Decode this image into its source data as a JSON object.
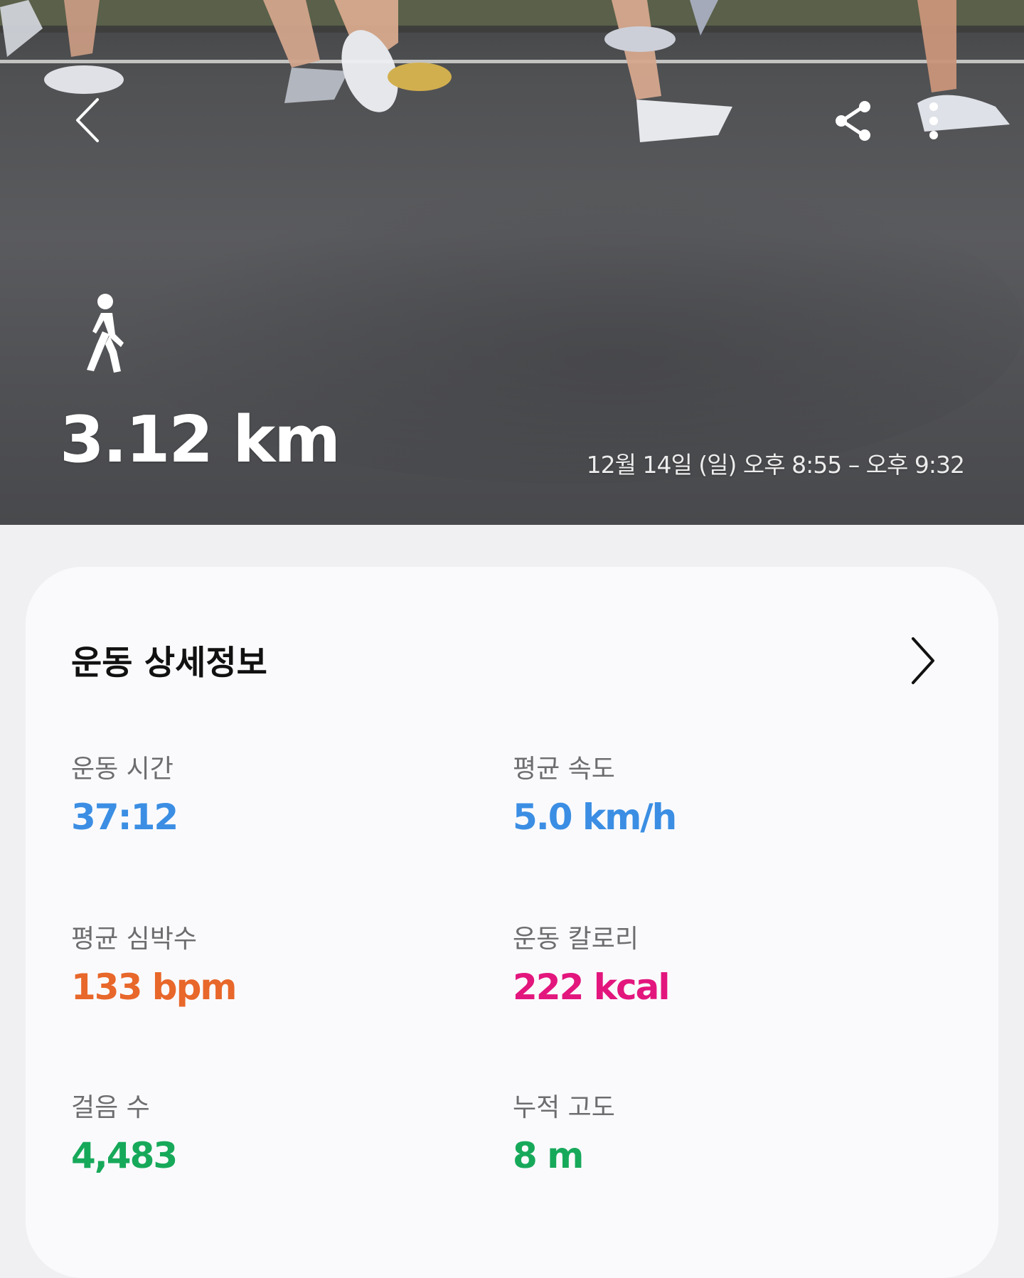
{
  "hero": {
    "distance": "3.12 km",
    "date_range": "12월 14일 (일) 오후 8:55 – 오후 9:32",
    "back_icon": "chevron-left-icon",
    "share_icon": "share-icon",
    "more_icon": "more-vertical-icon",
    "activity_icon": "walking-person-icon"
  },
  "details": {
    "title": "운동 상세정보",
    "chevron_icon": "chevron-right-icon",
    "stats": [
      {
        "label": "운동 시간",
        "value": "37:12",
        "color": "#3b8ee3"
      },
      {
        "label": "평균 속도",
        "value": "5.0 km/h",
        "color": "#3b8ee3"
      },
      {
        "label": "평균 심박수",
        "value": "133 bpm",
        "color": "#e8672a"
      },
      {
        "label": "운동 칼로리",
        "value": "222 kcal",
        "color": "#e3167d"
      },
      {
        "label": "걸음 수",
        "value": "4,483",
        "color": "#17a95a"
      },
      {
        "label": "누적 고도",
        "value": "8 m",
        "color": "#17a95a"
      }
    ]
  }
}
